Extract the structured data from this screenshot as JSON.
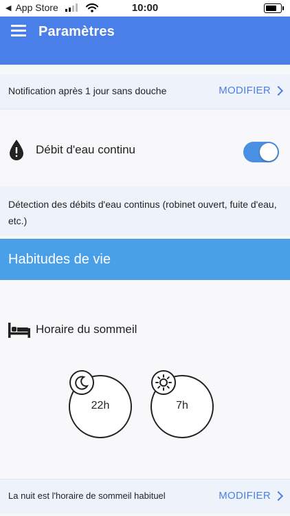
{
  "status_bar": {
    "back_label": "App Store",
    "time": "10:00"
  },
  "app_bar": {
    "title": "Paramètres",
    "menu_icon": "hamburger-menu-icon"
  },
  "notification_row": {
    "text": "Notification après 1 jour sans douche",
    "action_label": "MODIFIER"
  },
  "continuous_flow": {
    "icon": "water-drop-alert-icon",
    "label": "Débit d'eau continu",
    "enabled": true,
    "description": "Détection des débits d'eau continus (robinet ouvert, fuite d'eau, etc.)"
  },
  "habits_section": {
    "title": "Habitudes de vie"
  },
  "sleep": {
    "icon": "bed-icon",
    "label": "Horaire du sommeil",
    "bedtime": {
      "icon": "moon-icon",
      "value": "22h"
    },
    "wake": {
      "icon": "sun-icon",
      "value": "7h"
    }
  },
  "night_row": {
    "text": "La nuit est l'horaire de sommeil habituel",
    "action_label": "MODIFIER"
  },
  "colors": {
    "app_bar": "#4a7ee8",
    "section_header": "#4aa0e8",
    "accent": "#4a7ee8",
    "toggle_on": "#4a90e2"
  }
}
